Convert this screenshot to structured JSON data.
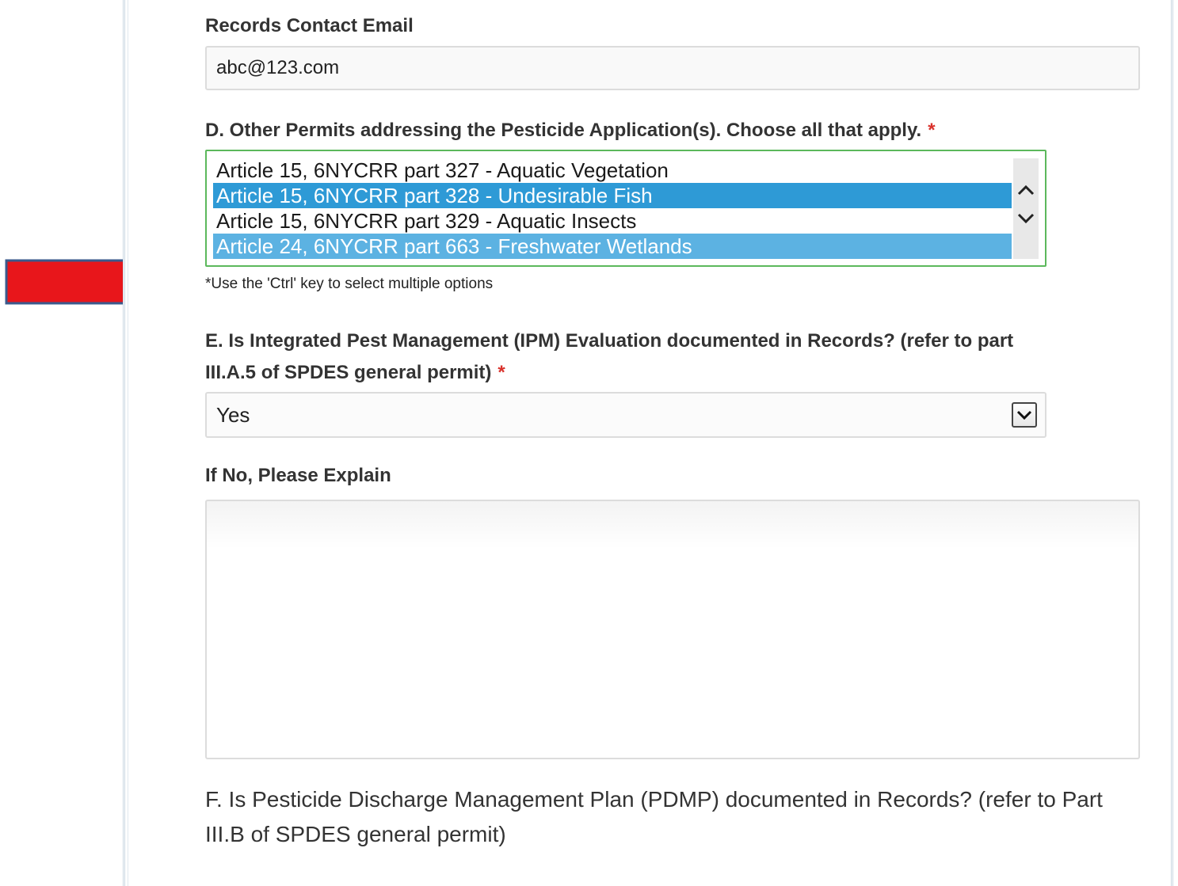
{
  "records_contact_email": {
    "label": "Records Contact Email",
    "value": "abc@123.com"
  },
  "other_permits": {
    "label": "D. Other Permits addressing the Pesticide Application(s). Choose all that apply.",
    "required_mark": "*",
    "options": [
      {
        "label": "Article 15, 6NYCRR part 327 - Aquatic Vegetation",
        "selected": false
      },
      {
        "label": "Article 15, 6NYCRR part 328 - Undesirable Fish",
        "selected": true
      },
      {
        "label": "Article 15, 6NYCRR part 329 - Aquatic Insects",
        "selected": false
      },
      {
        "label": "Article 24, 6NYCRR part 663 - Freshwater Wetlands",
        "selected": true
      }
    ],
    "hint": "*Use the 'Ctrl' key to select multiple options"
  },
  "ipm_evaluation": {
    "label_line1": "E. Is Integrated Pest Management (IPM) Evaluation documented in Records? (refer to part",
    "label_line2": "III.A.5 of SPDES general permit)",
    "required_mark": "*",
    "selected_value": "Yes"
  },
  "explain": {
    "label": "If No, Please Explain",
    "value": ""
  },
  "pdmp": {
    "label": "F. Is Pesticide Discharge Management Plan (PDMP) documented in Records? (refer to Part III.B of SPDES general permit)"
  },
  "colors": {
    "annotation_arrow": "#e8161b",
    "arrow_outline": "#3a5a8c",
    "selected_option": "#2e9ad6",
    "selected_option_secondary": "#5cb2e2",
    "focus_border": "#5cb85c",
    "required": "#d9312b"
  },
  "icons": {
    "annotation": "right-arrow-icon",
    "scroll_up": "chevron-up-icon",
    "scroll_down": "chevron-down-icon",
    "select": "chevron-down-icon"
  }
}
